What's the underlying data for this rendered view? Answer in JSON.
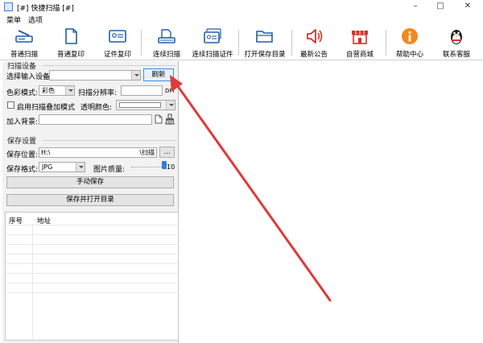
{
  "window": {
    "title": "[#] 快捷扫描 [#]",
    "controls": {
      "minimize": "–",
      "maximize": "□",
      "close": "✕"
    }
  },
  "menu": {
    "items": [
      "菜单",
      "选项"
    ]
  },
  "toolbar": {
    "buttons": [
      {
        "label": "普通扫描",
        "icon": "scanner-icon"
      },
      {
        "label": "普通复印",
        "icon": "document-icon"
      },
      {
        "label": "证件复印",
        "icon": "id-card-icon"
      },
      {
        "label": "连续扫描",
        "icon": "scanner-stack-icon"
      },
      {
        "label": "连续扫描证件",
        "icon": "id-card-stack-icon"
      },
      {
        "label": "打开保存目录",
        "icon": "folder-icon"
      },
      {
        "label": "最新公告",
        "icon": "speaker-icon"
      },
      {
        "label": "自营商城",
        "icon": "store-icon"
      },
      {
        "label": "帮助中心",
        "icon": "info-icon"
      },
      {
        "label": "联系客服",
        "icon": "qq-penguin-icon"
      }
    ]
  },
  "scan_settings": {
    "group_title": "扫描设备",
    "device_label": "选择输入设备:",
    "device_value": "",
    "refresh_button": "刷新",
    "color_mode_label": "色彩模式:",
    "color_mode_value": "彩色",
    "resolution_label": "扫描分辨率:",
    "resolution_value": "",
    "resolution_unit": "DPI",
    "overlay_label": "启用扫描叠加模式",
    "overlay_checked": false,
    "transparent_color_label": "透明颜色:",
    "background_label": "加入背景:",
    "background_value": ""
  },
  "save_settings": {
    "group_title": "保存设置",
    "location_label": "保存位置:",
    "location_prefix": "H:\\",
    "location_suffix": "\\扫描",
    "browse_button": "...",
    "format_label": "保存格式:",
    "format_value": "JPG",
    "quality_label": "图片质量:",
    "quality_value": "10",
    "quality_level": 1.0,
    "manual_save_button": "手动保存",
    "save_open_button": "保存并打开目录"
  },
  "file_list": {
    "columns": [
      "序号",
      "地址"
    ],
    "rows": []
  },
  "annotation": {
    "arrow_color": "#e0393b"
  }
}
